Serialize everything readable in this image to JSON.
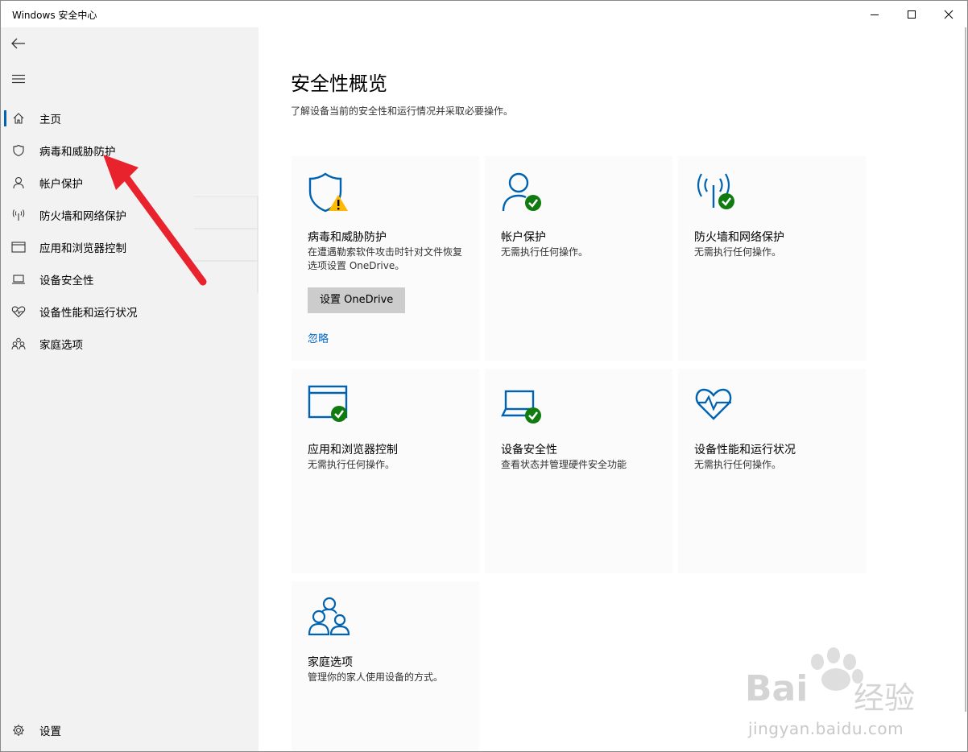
{
  "window": {
    "title": "Windows 安全中心"
  },
  "sidebar": {
    "items": [
      {
        "label": "主页",
        "icon": "home-icon"
      },
      {
        "label": "病毒和威胁防护",
        "icon": "shield-icon"
      },
      {
        "label": "帐户保护",
        "icon": "person-icon"
      },
      {
        "label": "防火墙和网络保护",
        "icon": "antenna-icon"
      },
      {
        "label": "应用和浏览器控制",
        "icon": "app-window-icon"
      },
      {
        "label": "设备安全性",
        "icon": "laptop-icon"
      },
      {
        "label": "设备性能和运行状况",
        "icon": "heart-pulse-icon"
      },
      {
        "label": "家庭选项",
        "icon": "family-icon"
      }
    ],
    "settings_label": "设置"
  },
  "main": {
    "title": "安全性概览",
    "description": "了解设备当前的安全性和运行情况并采取必要操作。",
    "tiles": [
      {
        "name": "病毒和威胁防护",
        "desc": "在遭遇勒索软件攻击时针对文件恢复选项设置 OneDrive。",
        "button": "设置 OneDrive",
        "link": "忽略",
        "status": "warning"
      },
      {
        "name": "帐户保护",
        "desc": "无需执行任何操作。",
        "status": "ok"
      },
      {
        "name": "防火墙和网络保护",
        "desc": "无需执行任何操作。",
        "status": "ok"
      },
      {
        "name": "应用和浏览器控制",
        "desc": "无需执行任何操作。",
        "status": "ok"
      },
      {
        "name": "设备安全性",
        "desc": "查看状态并管理硬件安全功能",
        "status": "ok"
      },
      {
        "name": "设备性能和运行状况",
        "desc": "无需执行任何操作。",
        "status": "none"
      },
      {
        "name": "家庭选项",
        "desc": "管理你的家人使用设备的方式。",
        "status": "none"
      }
    ]
  },
  "watermark": {
    "brand": "Bai",
    "brand_suffix": "经验",
    "url": "jingyan.baidu.com"
  },
  "colors": {
    "accent": "#0063b1",
    "ok_green": "#107c10",
    "warning_yellow": "#ffb900",
    "annotation_red": "#e8232e"
  }
}
